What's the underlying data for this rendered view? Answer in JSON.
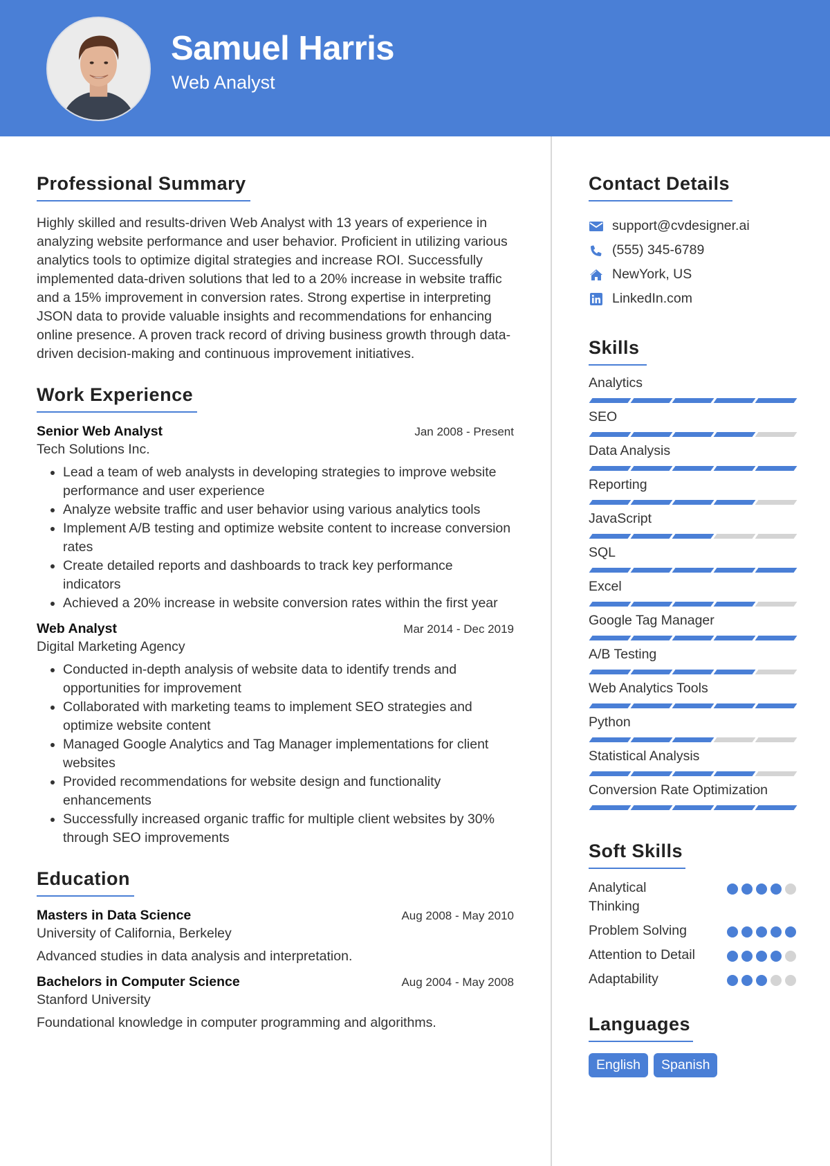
{
  "header": {
    "name": "Samuel Harris",
    "role": "Web Analyst",
    "accent_color": "#4a7fd6"
  },
  "summary": {
    "title": "Professional Summary",
    "text": "Highly skilled and results-driven Web Analyst with 13 years of experience in analyzing website performance and user behavior. Proficient in utilizing various analytics tools to optimize digital strategies and increase ROI. Successfully implemented data-driven solutions that led to a 20% increase in website traffic and a 15% improvement in conversion rates. Strong expertise in interpreting JSON data to provide valuable insights and recommendations for enhancing online presence. A proven track record of driving business growth through data-driven decision-making and continuous improvement initiatives."
  },
  "work": {
    "title": "Work Experience",
    "jobs": [
      {
        "title": "Senior Web Analyst",
        "date": "Jan 2008 - Present",
        "company": "Tech Solutions Inc.",
        "bullets": [
          "Lead a team of web analysts in developing strategies to improve website performance and user experience",
          "Analyze website traffic and user behavior using various analytics tools",
          "Implement A/B testing and optimize website content to increase conversion rates",
          "Create detailed reports and dashboards to track key performance indicators",
          "Achieved a 20% increase in website conversion rates within the first year"
        ]
      },
      {
        "title": "Web Analyst",
        "date": "Mar 2014 - Dec 2019",
        "company": "Digital Marketing Agency",
        "bullets": [
          "Conducted in-depth analysis of website data to identify trends and opportunities for improvement",
          "Collaborated with marketing teams to implement SEO strategies and optimize website content",
          "Managed Google Analytics and Tag Manager implementations for client websites",
          "Provided recommendations for website design and functionality enhancements",
          "Successfully increased organic traffic for multiple client websites by 30% through SEO improvements"
        ]
      }
    ]
  },
  "education": {
    "title": "Education",
    "items": [
      {
        "degree": "Masters in Data Science",
        "date": "Aug 2008 - May 2010",
        "school": "University of California, Berkeley",
        "description": "Advanced studies in data analysis and interpretation."
      },
      {
        "degree": "Bachelors in Computer Science",
        "date": "Aug 2004 - May 2008",
        "school": "Stanford University",
        "description": "Foundational knowledge in computer programming and algorithms."
      }
    ]
  },
  "contact": {
    "title": "Contact Details",
    "items": [
      {
        "icon": "envelope-icon",
        "text": "support@cvdesigner.ai"
      },
      {
        "icon": "phone-icon",
        "text": "(555) 345-6789"
      },
      {
        "icon": "home-icon",
        "text": "NewYork, US"
      },
      {
        "icon": "linkedin-icon",
        "text": "LinkedIn.com"
      }
    ]
  },
  "skills": {
    "title": "Skills",
    "max_level": 5,
    "items": [
      {
        "name": "Analytics",
        "level": 5
      },
      {
        "name": "SEO",
        "level": 4
      },
      {
        "name": "Data Analysis",
        "level": 5
      },
      {
        "name": "Reporting",
        "level": 4
      },
      {
        "name": "JavaScript",
        "level": 3
      },
      {
        "name": "SQL",
        "level": 5
      },
      {
        "name": "Excel",
        "level": 4
      },
      {
        "name": "Google Tag Manager",
        "level": 5
      },
      {
        "name": "A/B Testing",
        "level": 4
      },
      {
        "name": "Web Analytics Tools",
        "level": 5
      },
      {
        "name": "Python",
        "level": 3
      },
      {
        "name": "Statistical Analysis",
        "level": 4
      },
      {
        "name": "Conversion Rate Optimization",
        "level": 5
      }
    ]
  },
  "soft_skills": {
    "title": "Soft Skills",
    "max_level": 5,
    "items": [
      {
        "name": "Analytical Thinking",
        "level": 4
      },
      {
        "name": "Problem Solving",
        "level": 5
      },
      {
        "name": "Attention to Detail",
        "level": 4
      },
      {
        "name": "Adaptability",
        "level": 3
      }
    ]
  },
  "languages": {
    "title": "Languages",
    "items": [
      "English",
      "Spanish"
    ]
  }
}
